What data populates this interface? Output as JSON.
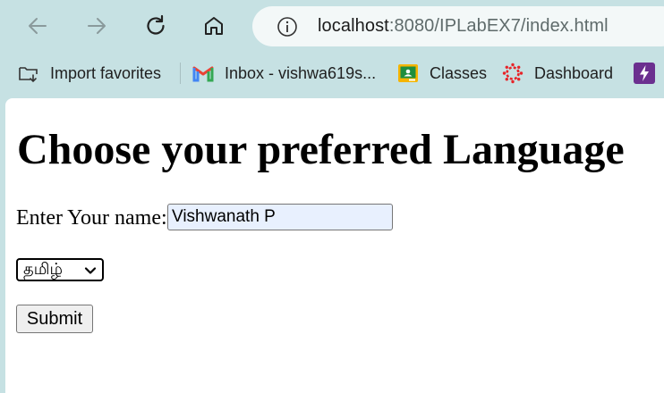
{
  "browser": {
    "address_host": "localhost",
    "address_path": ":8080/IPLabEX7/index.html"
  },
  "bookmarks": [
    {
      "label": "Import favorites",
      "icon": "import-favorites-icon"
    },
    {
      "label": "Inbox  - vishwa619s...",
      "icon": "gmail-icon"
    },
    {
      "label": "Classes",
      "icon": "google-classroom-icon"
    },
    {
      "label": "Dashboard",
      "icon": "canvas-dashboard-icon"
    },
    {
      "label": "",
      "icon": "bolt-app-icon"
    }
  ],
  "page": {
    "heading": "Choose your preferred Language",
    "name_label": "Enter Your name:",
    "name_value": "Vishwanath P",
    "language_selected": "தமிழ்",
    "submit_label": "Submit"
  },
  "colors": {
    "frame": "#c6e1e3",
    "input_autofill": "#e8f0fe",
    "gmail_red": "#ea4335",
    "classroom_yellow": "#f5b400",
    "canvas_red": "#e72429",
    "bolt_purple": "#6b2f8f"
  }
}
